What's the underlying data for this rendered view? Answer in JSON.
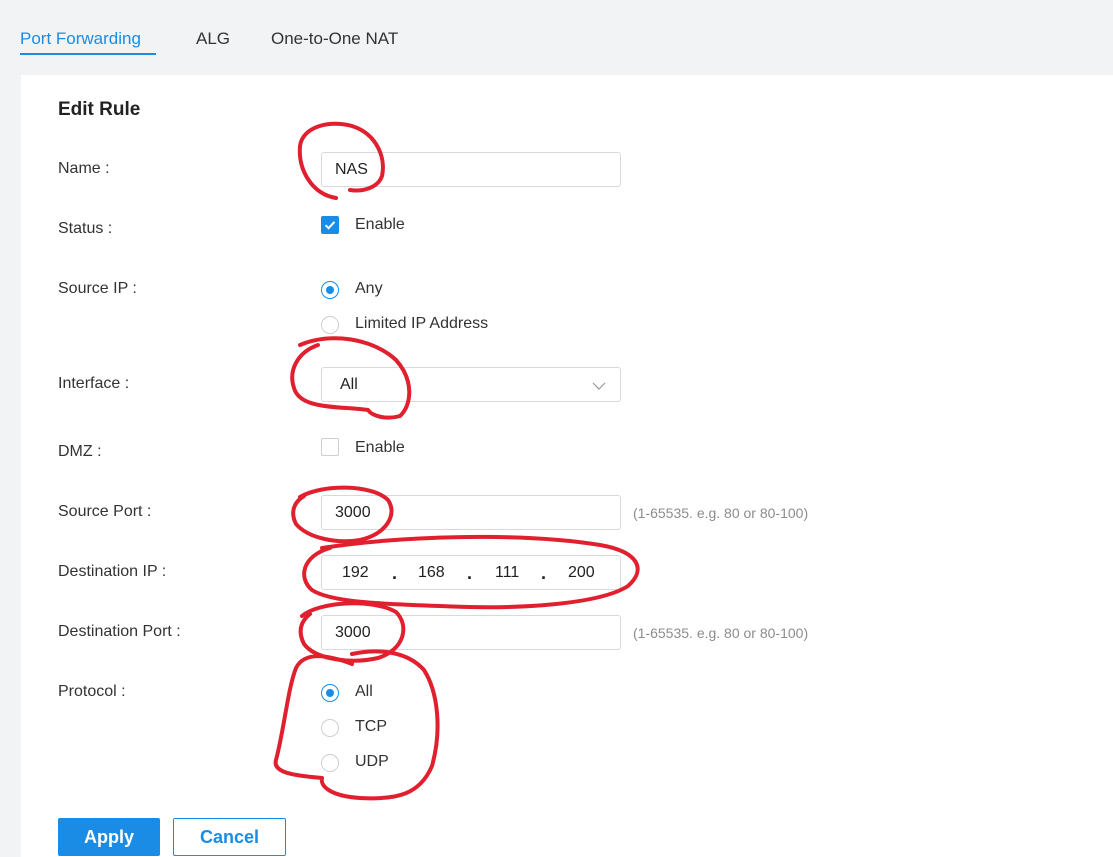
{
  "tabs": [
    {
      "label": "Port Forwarding",
      "active": true
    },
    {
      "label": "ALG",
      "active": false
    },
    {
      "label": "One-to-One NAT",
      "active": false
    }
  ],
  "form": {
    "title": "Edit Rule",
    "name": {
      "label": "Name",
      "value": "NAS"
    },
    "status": {
      "label": "Status",
      "checkbox_label": "Enable",
      "checked": true
    },
    "source_ip": {
      "label": "Source IP",
      "options": [
        "Any",
        "Limited IP Address"
      ],
      "selected": "Any"
    },
    "interface": {
      "label": "Interface",
      "value": "All"
    },
    "dmz": {
      "label": "DMZ",
      "checkbox_label": "Enable",
      "checked": false
    },
    "source_port": {
      "label": "Source Port",
      "value": "3000",
      "hint": "(1-65535. e.g. 80 or 80-100)"
    },
    "destination_ip": {
      "label": "Destination IP",
      "octets": [
        "192",
        "168",
        "111",
        "200"
      ]
    },
    "destination_port": {
      "label": "Destination Port",
      "value": "3000",
      "hint": "(1-65535. e.g. 80 or 80-100)"
    },
    "protocol": {
      "label": "Protocol",
      "options": [
        "All",
        "TCP",
        "UDP"
      ],
      "selected": "All"
    }
  },
  "buttons": {
    "apply": "Apply",
    "cancel": "Cancel"
  },
  "colors": {
    "accent": "#1a8ce6",
    "annotation": "#e0202e"
  }
}
